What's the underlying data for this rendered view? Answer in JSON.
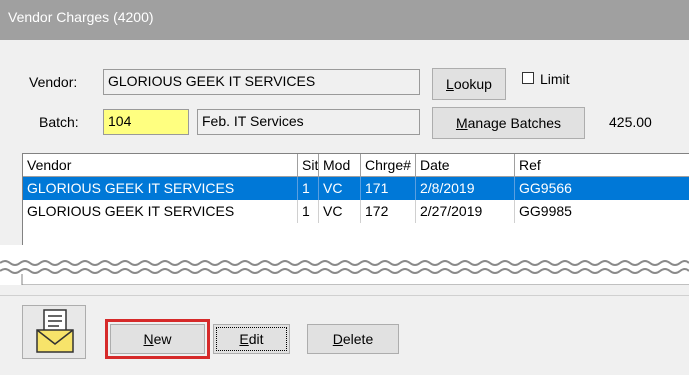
{
  "window": {
    "title": "Vendor Charges (4200)"
  },
  "form": {
    "vendor_label": "Vendor:",
    "vendor_value": "GLORIOUS GEEK IT SERVICES",
    "lookup_label_u": "L",
    "lookup_label_rest": "ookup",
    "limit_label": "Limi",
    "limit_label_u": "t",
    "batch_label": "Batch:",
    "batch_value": "104",
    "batch_desc": "Feb. IT Services",
    "manage_label_u": "M",
    "manage_label_rest": "anage Batches",
    "batch_total": "425.00"
  },
  "grid": {
    "columns": [
      "Vendor",
      "Site",
      "Mod",
      "Chrge#",
      "Date",
      "Ref"
    ],
    "rows": [
      [
        "GLORIOUS GEEK IT SERVICES",
        "1",
        "VC",
        "171",
        "2/8/2019",
        "GG9566"
      ],
      [
        "GLORIOUS GEEK IT SERVICES",
        "1",
        "VC",
        "172",
        "2/27/2019",
        "GG9985"
      ]
    ]
  },
  "buttons": {
    "new_u": "N",
    "new_rest": "ew",
    "edit_u": "E",
    "edit_rest": "dit",
    "delete_u": "D",
    "delete_rest": "elete"
  },
  "icons": {
    "document-envelope-icon": "document with envelope"
  },
  "colors": {
    "selection": "#0078d7",
    "batch_field": "#ffff80",
    "highlight": "#d62a2a",
    "titlebar": "#a0a0a0"
  }
}
